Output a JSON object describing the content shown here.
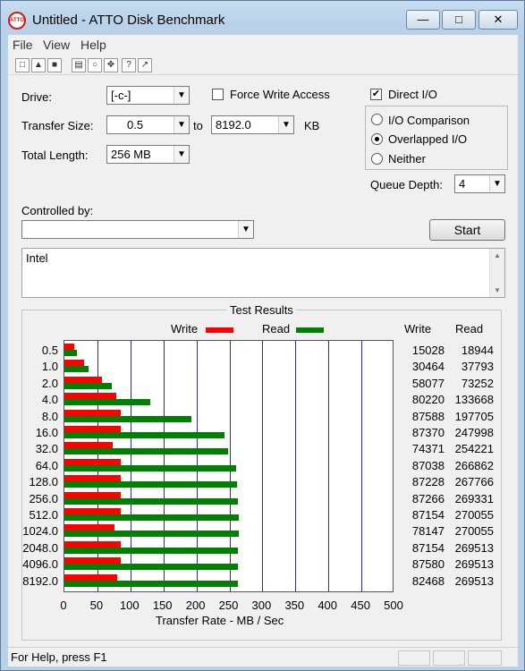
{
  "window": {
    "title": "Untitled - ATTO Disk Benchmark",
    "icon_text": "ATTO"
  },
  "menu": [
    "File",
    "View",
    "Help"
  ],
  "toolbar_icons": [
    "new-icon",
    "open-icon",
    "save-icon",
    "print-icon",
    "print-preview-icon",
    "move-icon",
    "help-icon",
    "context-help-icon"
  ],
  "settings": {
    "drive_label": "Drive:",
    "drive_value": "[-c-]",
    "force_write_label": "Force Write Access",
    "direct_io_label": "Direct I/O",
    "direct_io_checked": true,
    "transfer_size_label": "Transfer Size:",
    "transfer_from": "0.5",
    "to_label": "to",
    "transfer_to": "8192.0",
    "kb_label": "KB",
    "total_length_label": "Total Length:",
    "total_length_value": "256 MB",
    "io_comparison_label": "I/O Comparison",
    "overlapped_label": "Overlapped I/O",
    "neither_label": "Neither",
    "queue_depth_label": "Queue Depth:",
    "queue_depth_value": "4",
    "controlled_by_label": "Controlled by:",
    "controlled_by_value": "",
    "start_label": "Start",
    "notes_text": "Intel"
  },
  "results": {
    "title": "Test Results",
    "legend_write": "Write",
    "legend_read": "Read",
    "col_write": "Write",
    "col_read": "Read",
    "x_axis_label": "Transfer Rate - MB / Sec",
    "x_ticks": [
      "0",
      "50",
      "100",
      "150",
      "200",
      "250",
      "300",
      "350",
      "400",
      "450",
      "500"
    ],
    "colors": {
      "write": "#ff0000",
      "read": "#008000",
      "grid": "#2a2aa5"
    }
  },
  "chart_data": {
    "type": "bar",
    "title": "Test Results",
    "xlabel": "Transfer Rate - MB / Sec",
    "xlim": [
      0,
      500
    ],
    "categories": [
      "0.5",
      "1.0",
      "2.0",
      "4.0",
      "8.0",
      "16.0",
      "32.0",
      "64.0",
      "128.0",
      "256.0",
      "512.0",
      "1024.0",
      "2048.0",
      "4096.0",
      "8192.0"
    ],
    "series": [
      {
        "name": "Write",
        "values": [
          15028,
          30464,
          58077,
          80220,
          87588,
          87370,
          74371,
          87038,
          87228,
          87266,
          87154,
          78147,
          87154,
          87580,
          82468
        ]
      },
      {
        "name": "Read",
        "values": [
          18944,
          37793,
          73252,
          133668,
          197705,
          247998,
          254221,
          266862,
          267766,
          269331,
          270055,
          270055,
          269513,
          269513,
          269513
        ]
      }
    ]
  },
  "statusbar": {
    "help_text": "For Help, press F1"
  }
}
